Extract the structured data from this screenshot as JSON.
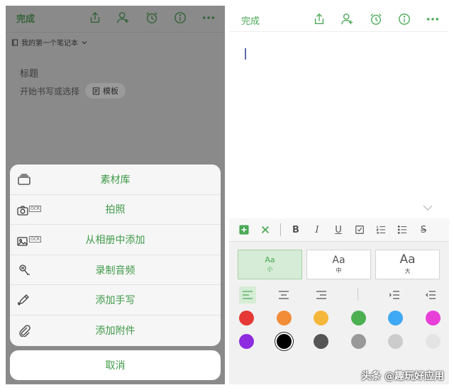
{
  "left": {
    "header": {
      "done_label": "完成",
      "icons": [
        "share-icon",
        "add-user-icon",
        "alarm-icon",
        "info-icon",
        "more-icon"
      ]
    },
    "notebook_label": "我的第一个笔记本",
    "note": {
      "title_placeholder": "标题",
      "body_placeholder": "开始书写或选择",
      "template_label": "模板"
    },
    "action_sheet": {
      "items": [
        {
          "label": "素材库",
          "icon": "library-icon"
        },
        {
          "label": "拍照",
          "icon": "camera-ocr-icon",
          "badge": "OCR"
        },
        {
          "label": "从相册中添加",
          "icon": "photo-ocr-icon",
          "badge": "OCR"
        },
        {
          "label": "录制音频",
          "icon": "microphone-icon"
        },
        {
          "label": "添加手写",
          "icon": "handwriting-icon"
        },
        {
          "label": "添加附件",
          "icon": "paperclip-icon"
        }
      ],
      "cancel_label": "取消"
    }
  },
  "right": {
    "header": {
      "done_label": "完成",
      "icons": [
        "share-icon",
        "add-user-icon",
        "alarm-icon",
        "info-icon",
        "more-icon"
      ]
    },
    "format_toolbar": [
      "plus-icon",
      "close-icon",
      "bold-icon",
      "italic-icon",
      "underline-icon",
      "checkbox-icon",
      "numbered-list-icon",
      "bulleted-list-icon",
      "strikethrough-icon"
    ],
    "toolbar_text": {
      "bold": "B",
      "italic": "I",
      "underline": "U",
      "strike": "S"
    },
    "sizes": [
      {
        "glyph": "Aa",
        "label": "小",
        "active": true
      },
      {
        "glyph": "Aa",
        "label": "中",
        "active": false
      },
      {
        "glyph": "Aa",
        "label": "大",
        "active": false
      }
    ],
    "alignment": [
      "align-left-icon",
      "align-center-icon",
      "align-right-icon",
      "indent-icon",
      "outdent-icon"
    ],
    "colors": [
      [
        "#e53935",
        "#f28c38",
        "#f5b73b",
        "#4caf50",
        "#3fa9f5",
        "#e83fd8"
      ],
      [
        "#8e2ce0",
        "#000000",
        "#555555",
        "#999999",
        "#cccccc",
        "#e4e4e4"
      ]
    ],
    "selected_color": "#000000"
  },
  "watermark": "头条 @趣玩好应用",
  "accent_color": "#4aa956"
}
